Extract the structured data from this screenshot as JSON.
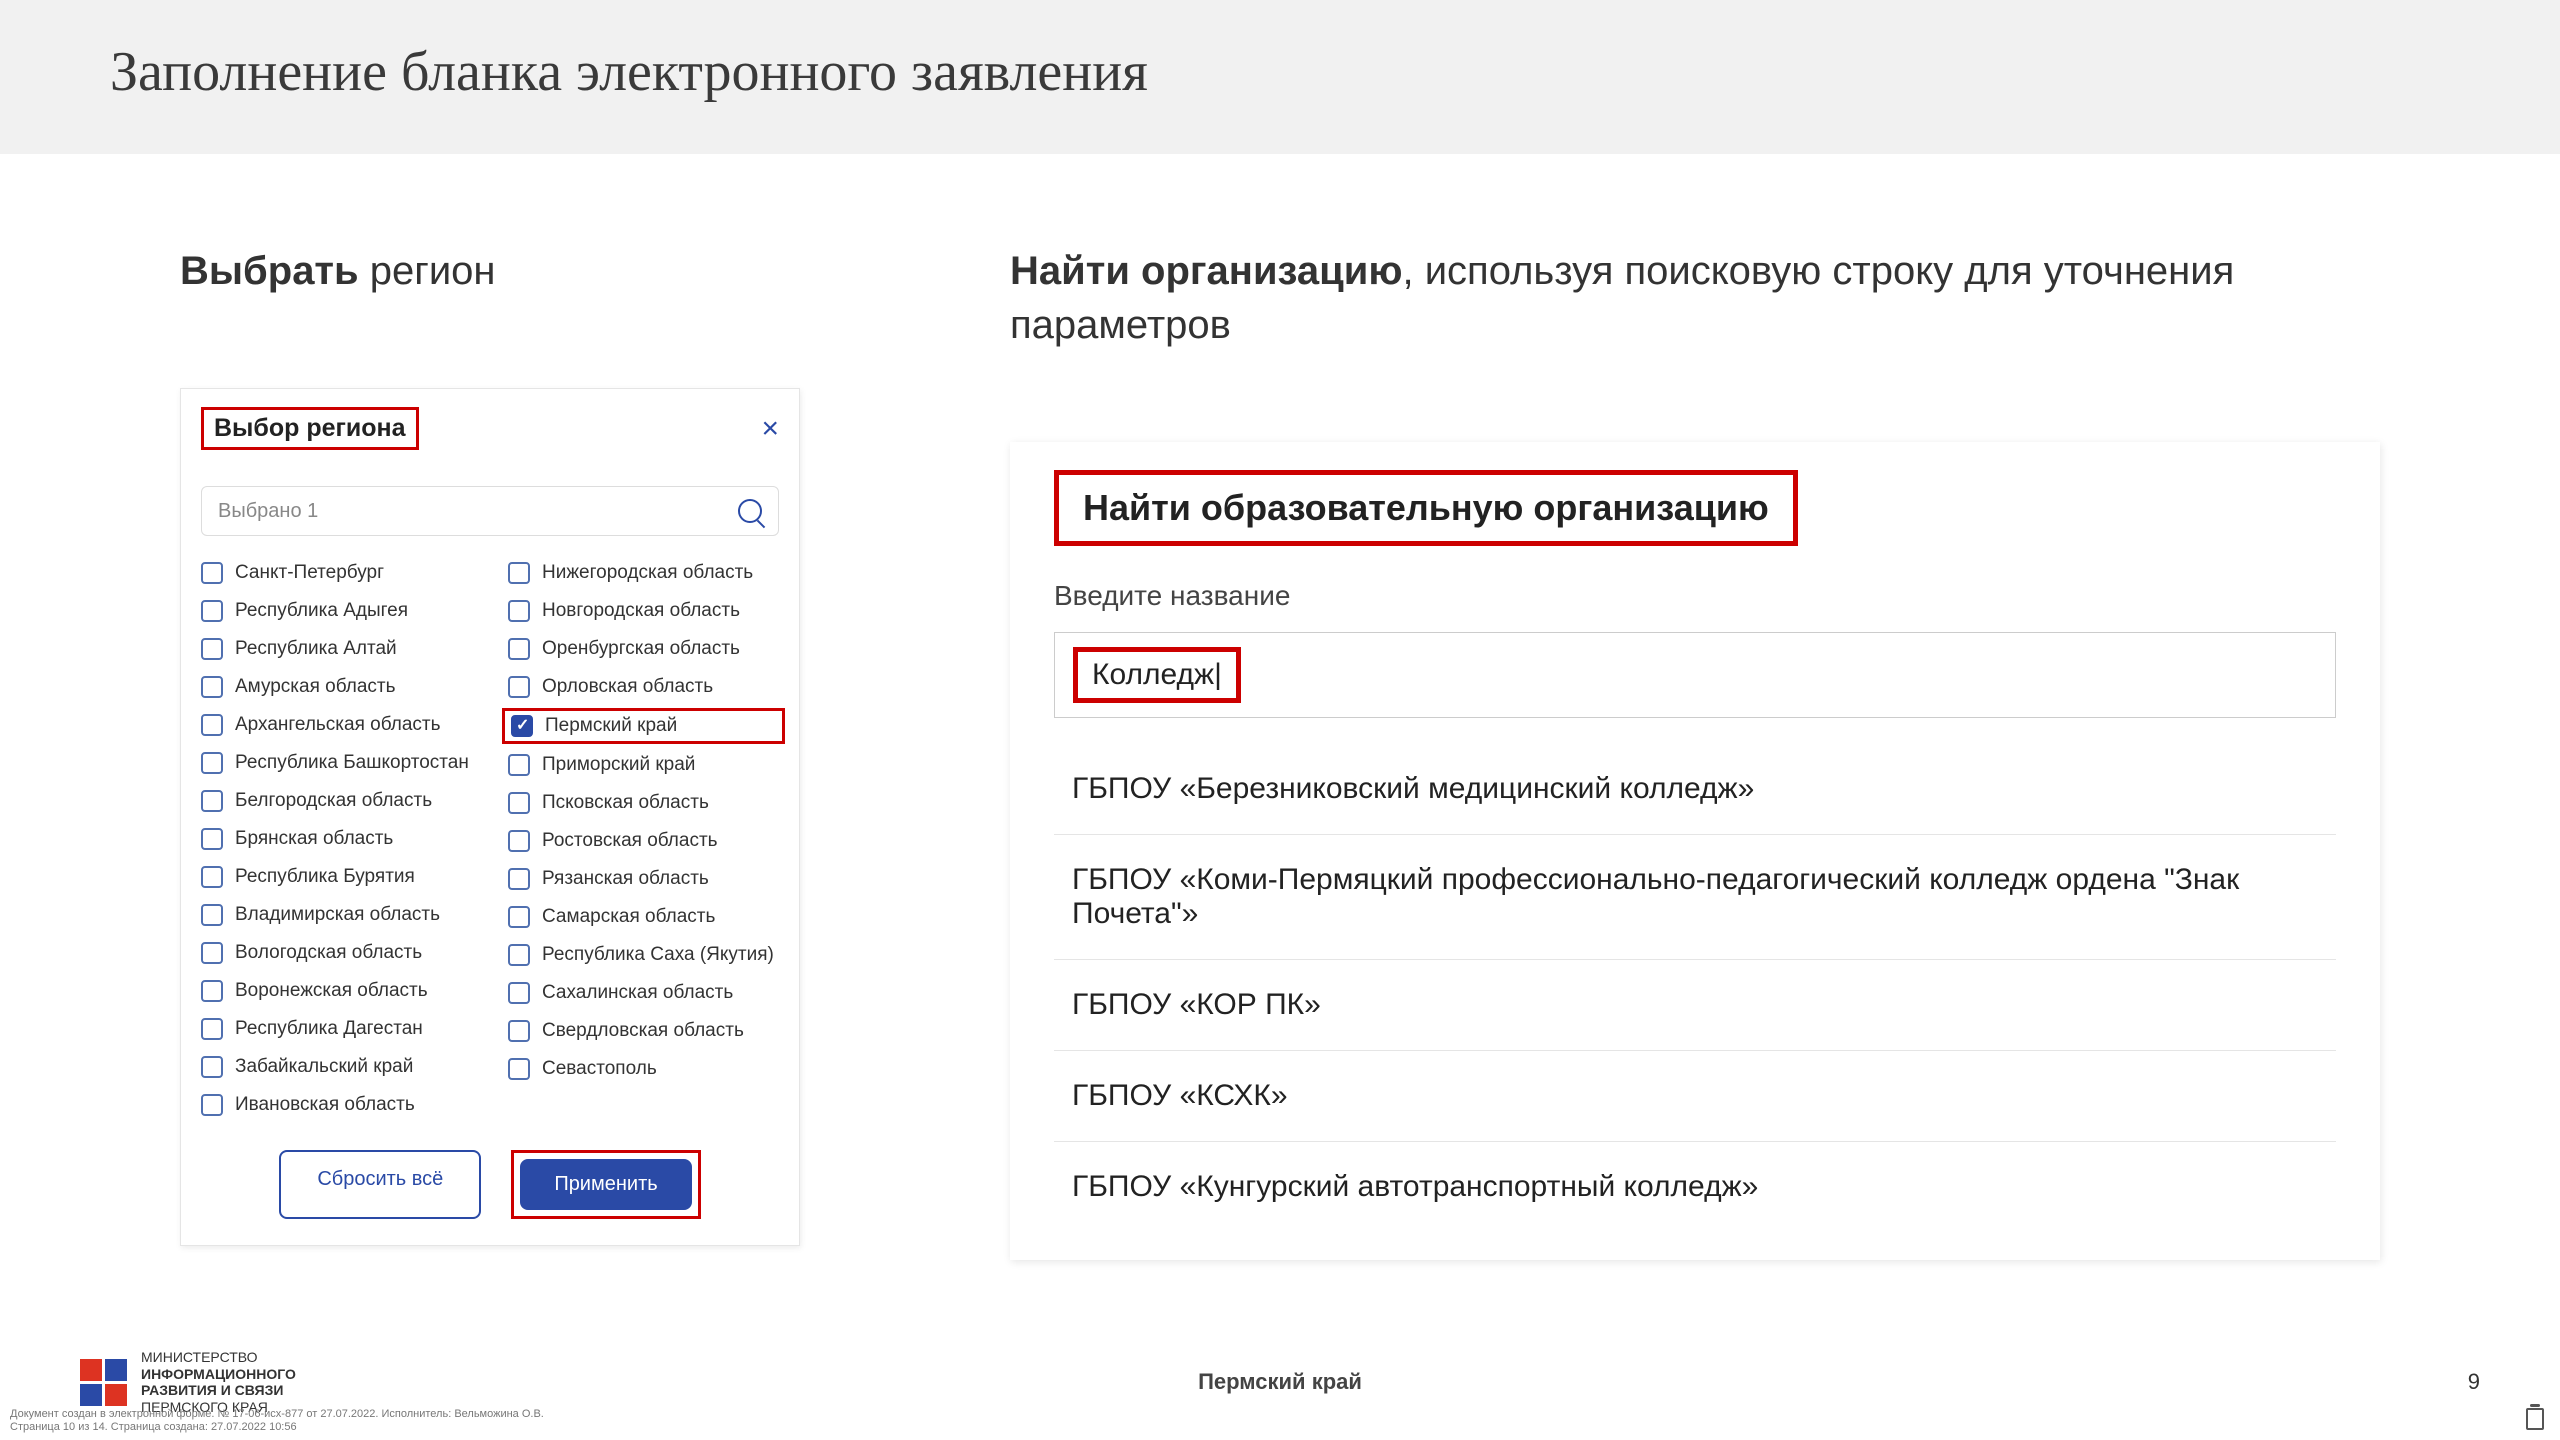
{
  "title": "Заполнение бланка электронного заявления",
  "left": {
    "heading_bold": "Выбрать",
    "heading_rest": " регион",
    "panel_title": "Выбор региона",
    "search_placeholder": "Выбрано 1",
    "col1": [
      "Санкт-Петербург",
      "Республика Адыгея",
      "Республика Алтай",
      "Амурская область",
      "Архангельская область",
      "Республика Башкортостан",
      "Белгородская область",
      "Брянская область",
      "Республика Бурятия",
      "Владимирская область",
      "Вологодская область",
      "Воронежская область",
      "Республика Дагестан",
      "Забайкальский край",
      "Ивановская область"
    ],
    "col2": [
      "Нижегородская область",
      "Новгородская область",
      "Оренбургская область",
      "Орловская область",
      "Пермский край",
      "Приморский край",
      "Псковская область",
      "Ростовская область",
      "Рязанская область",
      "Самарская область",
      "Республика Саха (Якутия)",
      "Сахалинская область",
      "Свердловская область",
      "Севастополь"
    ],
    "selected_index_col2": 4,
    "btn_reset": "Сбросить всё",
    "btn_apply": "Применить"
  },
  "right": {
    "heading_bold": "Найти организацию",
    "heading_rest": ", используя поисковую строку для уточнения параметров",
    "panel_title": "Найти образовательную организацию",
    "input_label": "Введите название",
    "input_value": "Колледж",
    "results": [
      "ГБПОУ «Березниковский медицинский колледж»",
      "ГБПОУ «Коми-Пермяцкий профессионально-педагогический колледж ордена \"Знак Почета\"»",
      "ГБПОУ «КОР ПК»",
      "ГБПОУ «КСХК»",
      "ГБПОУ «Кунгурский автотранспортный колледж»"
    ]
  },
  "footer": {
    "logo_line1": "МИНИСТЕРСТВО",
    "logo_line2": "ИНФОРМАЦИОННОГО",
    "logo_line3": "РАЗВИТИЯ И СВЯЗИ",
    "logo_line4": "ПЕРМСКОГО КРАЯ",
    "center": "Пермский край",
    "page": "9"
  },
  "doc_meta": "Документ создан в электронной форме. № 17-06-исх-877 от 27.07.2022. Исполнитель: Вельможина О.В.\nСтраница 10 из 14. Страница создана: 27.07.2022 10:56"
}
